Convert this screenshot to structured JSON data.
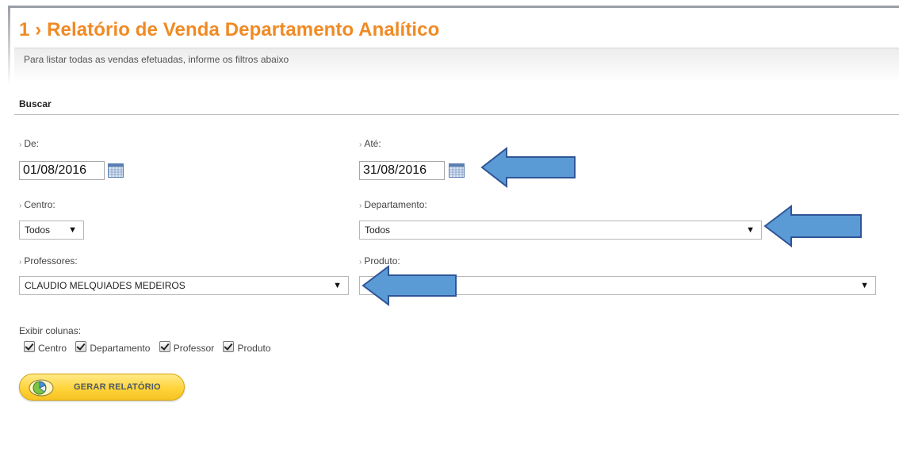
{
  "header": {
    "title": "1 › Relatório de Venda Departamento Analítico",
    "subtitle": "Para listar todas as vendas efetuadas, informe os filtros abaixo"
  },
  "search": {
    "section_title": "Buscar",
    "de": {
      "label": "De:",
      "value": "01/08/2016"
    },
    "ate": {
      "label": "Até:",
      "value": "31/08/2016"
    },
    "centro": {
      "label": "Centro:",
      "value": "Todos"
    },
    "departamento": {
      "label": "Departamento:",
      "value": "Todos"
    },
    "professores": {
      "label": "Professores:",
      "value": "CLAUDIO MELQUIADES MEDEIROS"
    },
    "produto": {
      "label": "Produto:",
      "value": ""
    },
    "label_arrow": "›"
  },
  "columns": {
    "label": "Exibir colunas:",
    "options": [
      {
        "label": "Centro",
        "checked": true
      },
      {
        "label": "Departamento",
        "checked": true
      },
      {
        "label": "Professor",
        "checked": true
      },
      {
        "label": "Produto",
        "checked": true
      }
    ]
  },
  "actions": {
    "generate_label": "GERAR RELATÓRIO"
  },
  "icons": {
    "calendar": "calendar-icon",
    "dropdown": "chevron-down-icon",
    "report": "chart-icon",
    "annotation": "arrow-left-icon"
  },
  "colors": {
    "title": "#f08a24",
    "button": "#ffd43a",
    "annotation_arrow": "#5b9bd5"
  }
}
